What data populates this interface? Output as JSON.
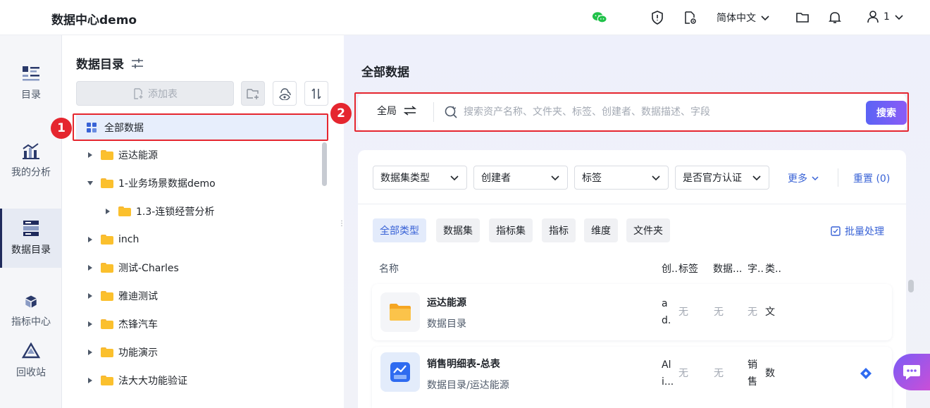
{
  "header": {
    "title": "数据中心demo",
    "language": "简体中文",
    "user": "1",
    "icons": [
      "wechat-icon",
      "shield-icon",
      "settings-file-icon",
      "folder-icon",
      "bell-icon",
      "user-icon"
    ]
  },
  "rail": {
    "items": [
      {
        "label": "目录"
      },
      {
        "label": "我的分析"
      },
      {
        "label": "数据目录"
      },
      {
        "label": "指标中心"
      },
      {
        "label": "回收站"
      }
    ]
  },
  "tree": {
    "title": "数据目录",
    "add_table_label": "添加表",
    "nodes": [
      {
        "label": "全部数据"
      },
      {
        "label": "运达能源"
      },
      {
        "label": "1-业务场景数据demo"
      },
      {
        "label": "1.3-连锁经营分析"
      },
      {
        "label": "inch"
      },
      {
        "label": "测试-Charles"
      },
      {
        "label": "雅迪测试"
      },
      {
        "label": "杰锋汽车"
      },
      {
        "label": "功能演示"
      },
      {
        "label": "法大大功能验证"
      }
    ]
  },
  "annotations": {
    "badge1": "1",
    "badge2": "2"
  },
  "main": {
    "title": "全部数据",
    "scope_label": "全局",
    "search_placeholder": "搜索资产名称、文件夹、标签、创建者、数据描述、字段",
    "search_button": "搜索",
    "filters": [
      {
        "label": "数据集类型"
      },
      {
        "label": "创建者"
      },
      {
        "label": "标签"
      },
      {
        "label": "是否官方认证"
      }
    ],
    "more_label": "更多",
    "reset_label": "重置 (0)",
    "type_chips": [
      {
        "label": "全部类型"
      },
      {
        "label": "数据集"
      },
      {
        "label": "指标集"
      },
      {
        "label": "指标"
      },
      {
        "label": "维度"
      },
      {
        "label": "文件夹"
      }
    ],
    "batch_label": "批量处理",
    "columns": [
      "名称",
      "创..",
      "标签",
      "数据...",
      "字..",
      "类.."
    ],
    "rows": [
      {
        "name": "运达能源",
        "path": "数据目录",
        "creator_1": "a",
        "creator_2": "d.",
        "tag": "无",
        "data": "无",
        "field": "无",
        "type": "文"
      },
      {
        "name": "销售明细表-总表",
        "path": "数据目录/运达能源",
        "creator_1": "Al",
        "creator_2": "i...",
        "tag": "无",
        "data": "无",
        "field_1": "销",
        "field_2": "售",
        "type": "数"
      }
    ]
  },
  "colors": {
    "accent": "#3862d6",
    "highlight": "#e5262f",
    "search_btn": "#6c5cf6",
    "folder": "#fbc02d"
  }
}
